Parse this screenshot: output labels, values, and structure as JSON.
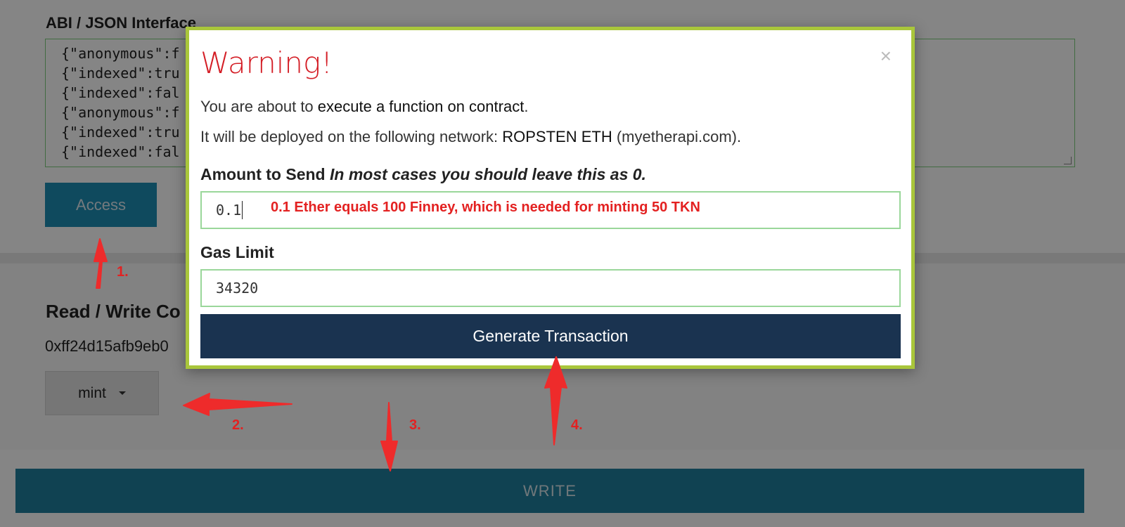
{
  "abi": {
    "label": "ABI / JSON Interface",
    "lines": [
      "{\"anonymous\":f",
      "{\"indexed\":tru",
      "{\"indexed\":fal",
      "{\"anonymous\":f",
      "{\"indexed\":tru",
      "{\"indexed\":fal"
    ]
  },
  "access_button": "Access",
  "read_write": {
    "label": "Read / Write Co",
    "address": "0xff24d15afb9eb0"
  },
  "mint_dropdown": {
    "selected": "mint"
  },
  "write_button": "WRITE",
  "modal": {
    "title": "Warning!",
    "close": "×",
    "line1_prefix": "You are about to ",
    "line1_strong": "execute a function on contract",
    "line1_suffix": ".",
    "line2_prefix": "It will be deployed on the following network: ",
    "line2_strong": "ROPSTEN ETH",
    "line2_suffix": " (myetherapi.com).",
    "amount_label": "Amount to Send",
    "amount_hint": "In most cases you should leave this as 0.",
    "amount_value": "0.1",
    "gas_label": "Gas Limit",
    "gas_value": "34320",
    "generate_button": "Generate Transaction"
  },
  "annotations": {
    "note": "0.1 Ether equals 100 Finney, which is needed for minting 50 TKN",
    "step1": "1.",
    "step2": "2.",
    "step3": "3.",
    "step4": "4.",
    "color": "#e32121"
  }
}
